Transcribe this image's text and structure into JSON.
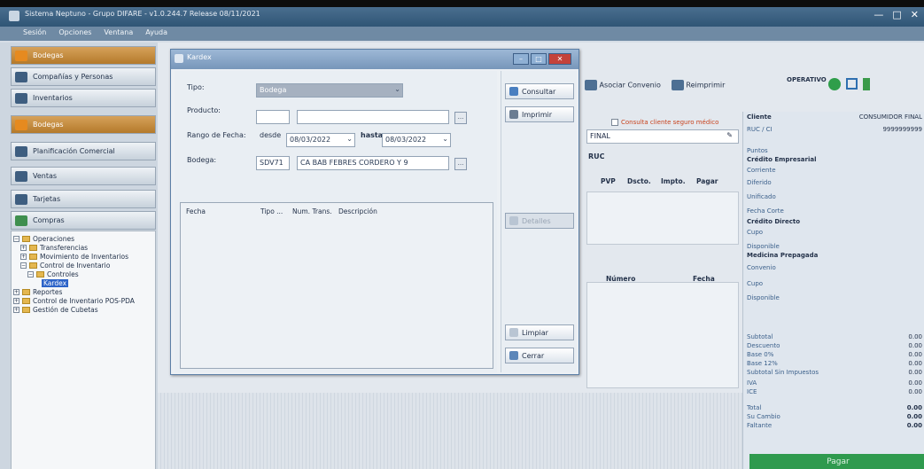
{
  "window": {
    "title": "Sistema Neptuno - Grupo DIFARE - v1.0.244.7 Release 08/11/2021",
    "menu": [
      "Sesión",
      "Opciones",
      "Ventana",
      "Ayuda"
    ]
  },
  "nav": {
    "buttons": [
      {
        "label": "Bodegas"
      },
      {
        "label": "Compañías y Personas"
      },
      {
        "label": "Inventarios"
      },
      {
        "label": "Bodegas"
      },
      {
        "label": "Planificación Comercial"
      },
      {
        "label": "Ventas"
      },
      {
        "label": "Tarjetas"
      },
      {
        "label": "Compras"
      }
    ],
    "tree": [
      {
        "label": "Operaciones"
      },
      {
        "label": "Transferencias"
      },
      {
        "label": "Movimiento de Inventarios"
      },
      {
        "label": "Control de Inventario"
      },
      {
        "label": "Controles"
      },
      {
        "label": "Kardex"
      },
      {
        "label": "Reportes"
      },
      {
        "label": "Control de Inventario POS-PDA"
      },
      {
        "label": "Gestión de Cubetas"
      }
    ]
  },
  "background": {
    "asociar_convenio": "Asociar Convenio",
    "reimprimir": "Reimprimir",
    "status": "OPERATIVO",
    "consulta_cliente": "Consulta cliente seguro médico",
    "final_label": "FINAL",
    "ruc_label": "RUC",
    "columns": [
      "PVP",
      "Dscto.",
      "Impto.",
      "Pagar"
    ],
    "columns2": [
      "Número",
      "Fecha"
    ],
    "right_panel": {
      "cliente": "Cliente",
      "consumidor_final": "CONSUMIDOR FINAL",
      "ruc_ci": "RUC / CI",
      "ruc_value": "9999999999",
      "puntos": "Puntos",
      "credito_empresarial": "Crédito Empresarial",
      "corriente": "Corriente",
      "diferido": "Diferido",
      "unificado": "Unificado",
      "fecha_corte": "Fecha Corte",
      "credito_directo": "Crédito Directo",
      "cupo": "Cupo",
      "disponible": "Disponible",
      "medicina_prepagada": "Medicina Prepagada",
      "convenio": "Convenio",
      "cupo2": "Cupo",
      "disponible2": "Disponible",
      "subtotal": "Subtotal",
      "descuento": "Descuento",
      "base0": "Base 0%",
      "base12": "Base 12%",
      "subtotal_sin": "Subtotal Sin Impuestos",
      "iva": "IVA",
      "ice": "ICE",
      "total": "Total",
      "su_cambio": "Su Cambio",
      "faltante": "Faltante",
      "amount": "0.00"
    },
    "pagar": "Pagar"
  },
  "kardex": {
    "title": "Kardex",
    "tipo_label": "Tipo:",
    "tipo_value": "Bodega",
    "producto_label": "Producto:",
    "rango_label": "Rango de Fecha:",
    "desde_label": "desde",
    "desde_value": "08/03/2022",
    "hasta_label": "hasta",
    "hasta_value": "08/03/2022",
    "bodega_label": "Bodega:",
    "bodega_code": "SDV71",
    "bodega_name": "CA BAB FEBRES CORDERO Y 9",
    "grid_columns": [
      "Fecha",
      "Tipo ...",
      "Num. Trans.",
      "Descripción"
    ],
    "buttons": {
      "consultar": "Consultar",
      "imprimir": "Imprimir",
      "detalles": "Detalles",
      "limpiar": "Limpiar",
      "cerrar": "Cerrar"
    },
    "ellipsis": "..."
  }
}
